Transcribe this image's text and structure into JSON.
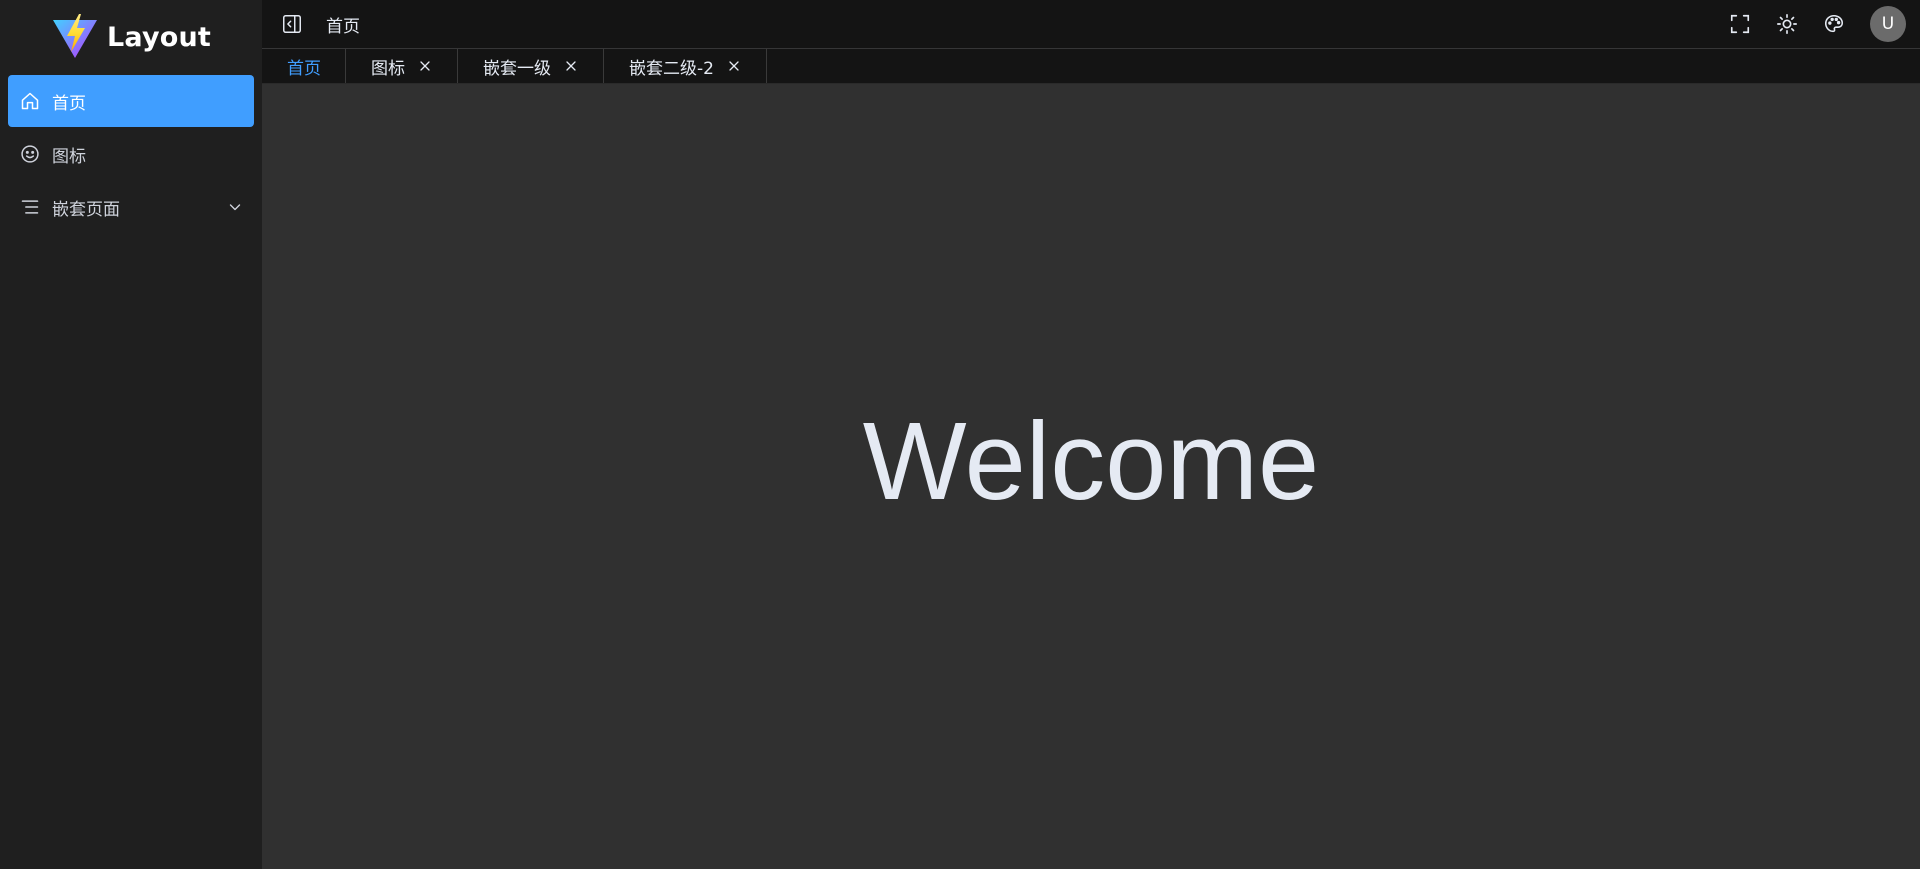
{
  "app": {
    "title": "Layout"
  },
  "sidebar": {
    "items": [
      {
        "label": "首页",
        "icon": "home-icon",
        "active": true
      },
      {
        "label": "图标",
        "icon": "smile-icon",
        "active": false
      },
      {
        "label": "嵌套页面",
        "icon": "menu-lines-icon",
        "active": false,
        "expandable": true
      }
    ]
  },
  "header": {
    "breadcrumb": "首页",
    "actions": [
      "fullscreen-icon",
      "sun-icon",
      "palette-icon"
    ],
    "avatar": "U"
  },
  "tabs": [
    {
      "label": "首页",
      "closable": false,
      "active": true
    },
    {
      "label": "图标",
      "closable": true,
      "active": false
    },
    {
      "label": "嵌套一级",
      "closable": true,
      "active": false
    },
    {
      "label": "嵌套二级-2",
      "closable": true,
      "active": false
    }
  ],
  "main": {
    "welcome": "Welcome"
  },
  "colors": {
    "accent": "#409eff",
    "sidebar_bg": "#1f1f1f",
    "header_bg": "#141414",
    "content_bg": "#303030"
  }
}
